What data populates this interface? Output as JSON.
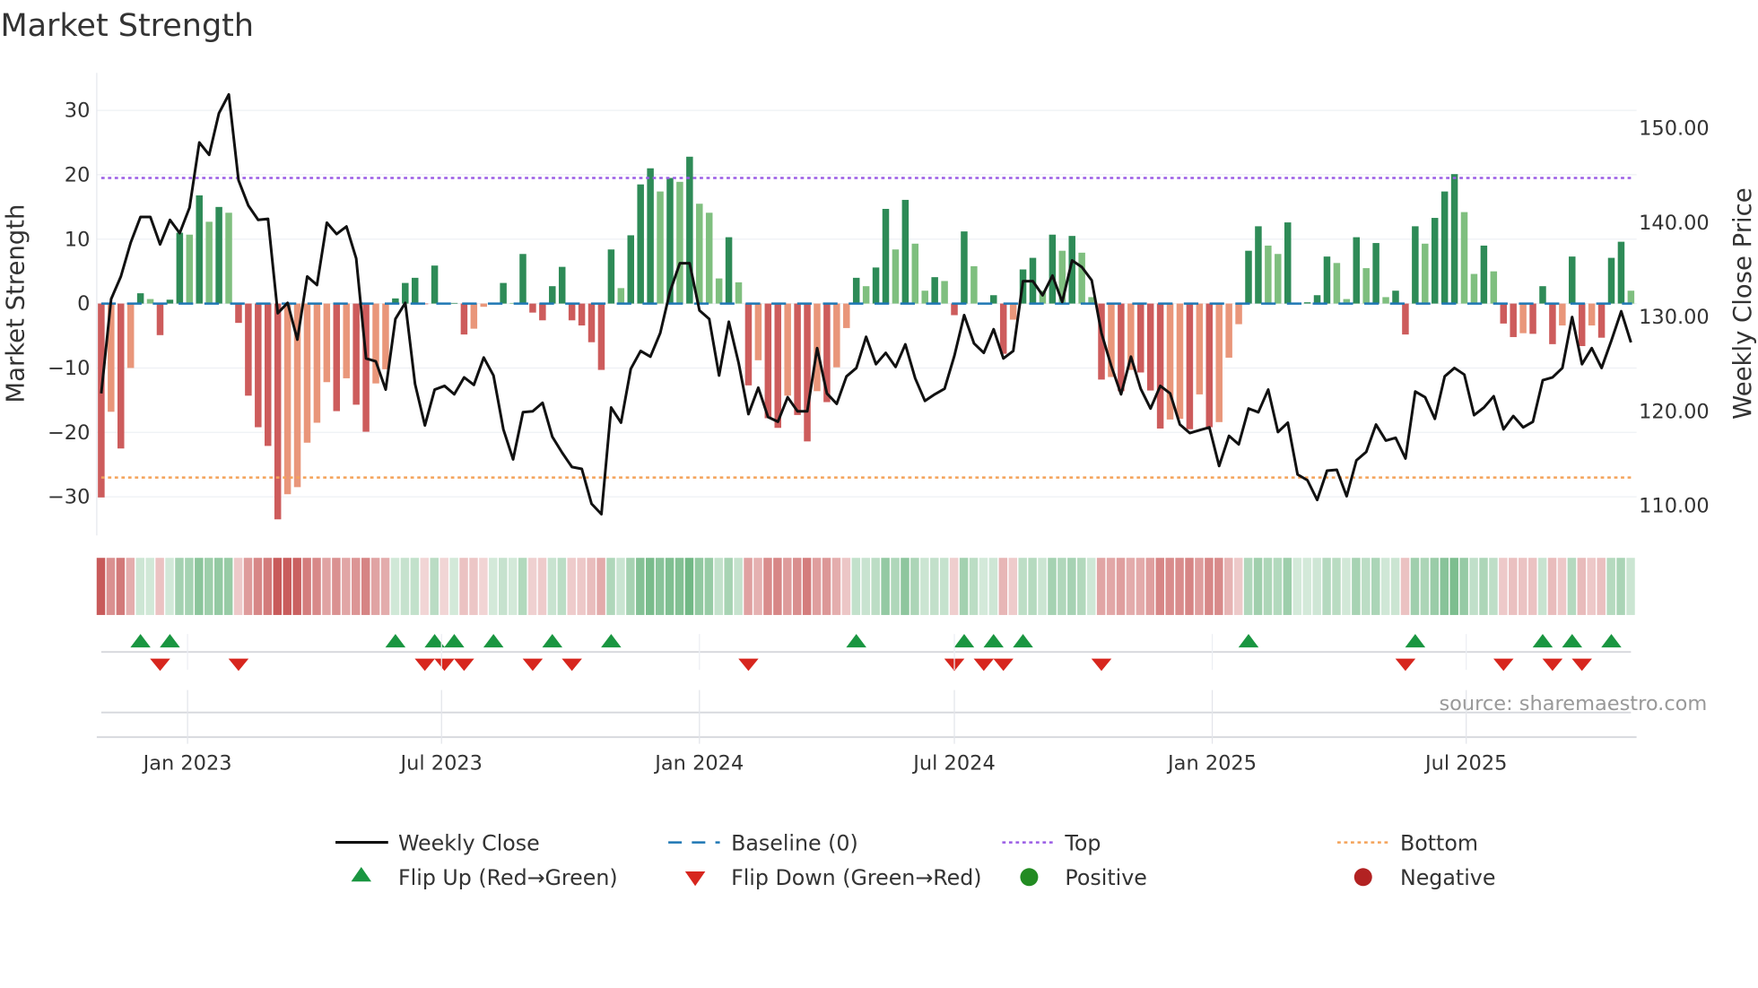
{
  "chart_data": {
    "type": "bar",
    "title": "Market Strength",
    "ylabel": "Market Strength",
    "y2label": "Weekly Close Price",
    "ylim": [
      -35,
      35
    ],
    "y2lim": [
      108,
      155
    ],
    "yticks": [
      "30",
      "20",
      "10",
      "0",
      "−10",
      "−20",
      "−30"
    ],
    "ytick_values": [
      30,
      20,
      10,
      0,
      -10,
      -20,
      -30
    ],
    "y2ticks": [
      "150.00",
      "140.00",
      "130.00",
      "120.00",
      "110.00"
    ],
    "y2tick_values": [
      150,
      140,
      130,
      120,
      110
    ],
    "x_unit": "week index",
    "xticks": [
      {
        "label": "Jan 2023",
        "week": 8.8
      },
      {
        "label": "Jul 2023",
        "week": 34.7
      },
      {
        "label": "Jan 2024",
        "week": 61.0
      },
      {
        "label": "Jul 2024",
        "week": 87.0
      },
      {
        "label": "Jan 2025",
        "week": 113.3
      },
      {
        "label": "Jul 2025",
        "week": 139.2
      }
    ],
    "top_level": 19.5,
    "bottom_level": -27,
    "baseline": 0,
    "strength": [
      -30.1,
      -16.8,
      -22.5,
      -10,
      1.6,
      0.7,
      -4.9,
      0.6,
      11,
      10.7,
      16.8,
      12.7,
      15,
      14.1,
      -3,
      -14.3,
      -19.2,
      -22.1,
      -33.5,
      -29.6,
      -28.5,
      -21.6,
      -18.5,
      -12.2,
      -16.7,
      -11.6,
      -15.7,
      -19.9,
      -12.4,
      -10.2,
      0.8,
      3.2,
      4,
      -0.1,
      5.9,
      -0.1,
      0.1,
      -4.8,
      -3.9,
      -0.5,
      0.1,
      3.2,
      0.1,
      7.7,
      -1.4,
      -2.6,
      2.7,
      5.7,
      -2.6,
      -3.4,
      -6,
      -10.3,
      8.4,
      2.4,
      10.6,
      18.5,
      21,
      17.4,
      19.5,
      18.9,
      22.8,
      15.5,
      14.1,
      3.9,
      10.3,
      3.3,
      -12.7,
      -8.8,
      -17.8,
      -19.3,
      -14.3,
      -17.3,
      -21.4,
      -13.6,
      -15.3,
      -9.9,
      -3.8,
      4,
      2.7,
      5.6,
      14.7,
      8.4,
      16.1,
      9.3,
      2,
      4.1,
      3.5,
      -1.8,
      11.2,
      5.8,
      0.1,
      1.3,
      -7.8,
      -2.5,
      5.3,
      7.1,
      2,
      10.7,
      8.2,
      10.5,
      7.9,
      1,
      -11.8,
      -11.4,
      -13.6,
      -10.3,
      -10.7,
      -13.5,
      -19.4,
      -18,
      -17.9,
      -19.5,
      -14.1,
      -19.2,
      -18.4,
      -8.4,
      -3.2,
      8.2,
      12,
      9,
      7.7,
      12.6,
      0.1,
      0.2,
      1.3,
      7.3,
      6.3,
      0.7,
      10.3,
      5.5,
      9.4,
      1,
      2,
      -4.8,
      12,
      9.3,
      13.3,
      17.4,
      20.1,
      14.2,
      4.6,
      9,
      5,
      -3.1,
      -5.2,
      -4.6,
      -4.7,
      2.7,
      -6.3,
      -3.4,
      7.3,
      -6.6,
      -3.4,
      -5.3,
      7.1,
      9.6,
      2
    ],
    "weekly_close": [
      121.9,
      131.9,
      134.3,
      137.9,
      140.6,
      140.6,
      137.7,
      140.3,
      138.9,
      141.6,
      148.5,
      147.2,
      151.6,
      153.6,
      144.5,
      141.8,
      140.3,
      140.4,
      130.4,
      131.5,
      127.6,
      134.3,
      133.4,
      140,
      138.8,
      139.6,
      136.2,
      125.6,
      125.3,
      122.3,
      129.8,
      131.5,
      122.9,
      118.5,
      122.3,
      122.7,
      121.8,
      123.6,
      122.8,
      125.7,
      123.8,
      118.1,
      114.9,
      119.9,
      120,
      120.9,
      117.3,
      115.6,
      114.1,
      113.9,
      110.2,
      109.1,
      120.4,
      118.8,
      124.5,
      126.4,
      125.8,
      128.3,
      132.7,
      135.7,
      135.7,
      130.7,
      129.8,
      123.8,
      129.5,
      125.1,
      119.7,
      122.5,
      119.4,
      118.9,
      121.5,
      120,
      120,
      126.7,
      121.9,
      120.8,
      123.7,
      124.6,
      127.9,
      125,
      126.2,
      124.7,
      127.1,
      123.5,
      121.1,
      121.8,
      122.4,
      125.9,
      130.2,
      127.2,
      126.2,
      128.7,
      125.6,
      126.4,
      133.8,
      133.8,
      132.3,
      134.4,
      131.6,
      136,
      135.3,
      133.9,
      128.3,
      124.8,
      121.8,
      125.8,
      122.4,
      120.3,
      122.7,
      121.9,
      118.6,
      117.7,
      118,
      118.3,
      114.2,
      117.4,
      116.5,
      120.3,
      119.9,
      122.3,
      117.8,
      118.8,
      113.3,
      112.7,
      110.6,
      113.7,
      113.8,
      111,
      114.8,
      115.7,
      118.6,
      116.9,
      117.2,
      115,
      122.1,
      121.5,
      119.2,
      123.7,
      124.6,
      123.9,
      119.6,
      120.4,
      121.6,
      118.1,
      119.5,
      118.3,
      118.9,
      123.3,
      123.6,
      124.6,
      130,
      125,
      126.7,
      124.6,
      127.5,
      130.6,
      127.3
    ],
    "flip_up_weeks": [
      4,
      7,
      30,
      34,
      36,
      40,
      46,
      52,
      77,
      88,
      91,
      94,
      117,
      134,
      147,
      150,
      154
    ],
    "flip_down_weeks": [
      6,
      14,
      33,
      35,
      37,
      44,
      48,
      66,
      87,
      90,
      92,
      102,
      133,
      143,
      148,
      151
    ],
    "legend": {
      "placement": "bottom",
      "weekly_close": "Weekly Close",
      "baseline": "Baseline (0)",
      "top": "Top",
      "bottom": "Bottom",
      "flip_up": "Flip Up (Red→Green)",
      "flip_down": "Flip Down (Green→Red)",
      "positive": "Positive",
      "negative": "Negative"
    },
    "source": "source: sharemaestro.com",
    "colors": {
      "pos_strong": "#2e8b57",
      "pos_weak": "#7fbf7f",
      "neg_strong": "#cd5c5c",
      "neg_weak": "#e9967a",
      "price": "#111111",
      "baseline": "#1f77b4",
      "top": "#9b5de5",
      "bottom": "#f4a259",
      "flip_up": "#1a9641",
      "flip_down": "#d7261e",
      "positive": "#228b22",
      "negative": "#b22222"
    }
  }
}
